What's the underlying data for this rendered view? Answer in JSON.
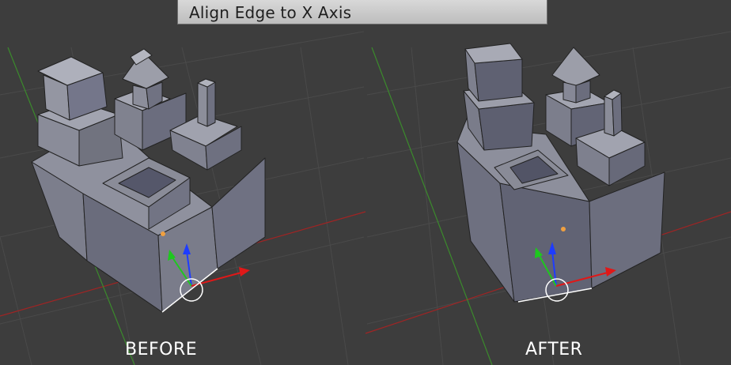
{
  "header": {
    "title": "Align Edge to X Axis"
  },
  "panels": {
    "before_label": "BEFORE",
    "after_label": "AFTER"
  },
  "colors": {
    "viewport_bg": "#3d3d3d",
    "grid_line": "#4a4a4a",
    "x_axis": "#a02424",
    "y_axis": "#3b8a2c",
    "mesh_face_light": "#8a8c99",
    "mesh_face_mid": "#6e7080",
    "mesh_face_dark": "#55576a",
    "mesh_edge": "#222222",
    "manipulator_x": "#e01818",
    "manipulator_y": "#1ec81e",
    "manipulator_z": "#1e3cff",
    "object_origin": "#f0a040",
    "selected_edge": "#ffffff"
  }
}
